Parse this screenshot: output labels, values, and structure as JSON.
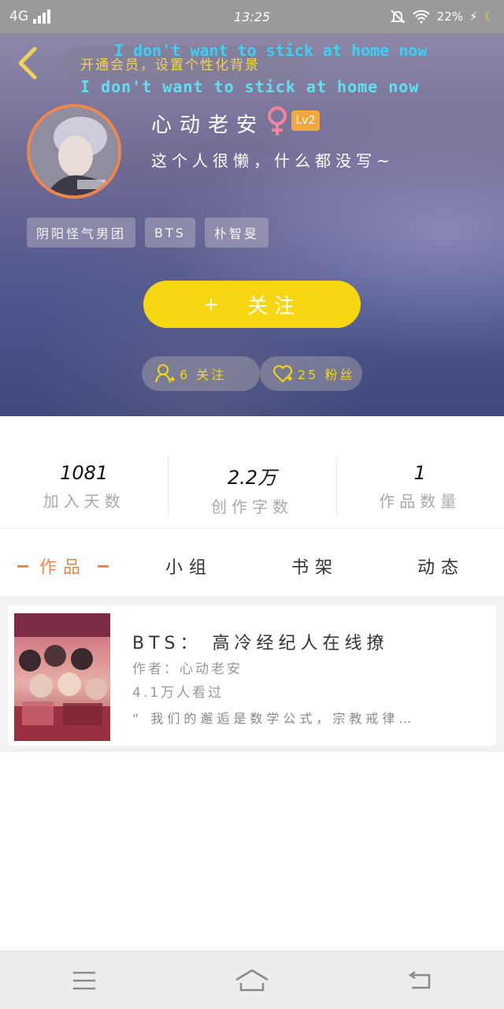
{
  "status_bar": {
    "network": "4G",
    "time": "13:25",
    "battery": "22%"
  },
  "header": {
    "vip_banner": "开通会员，设置个性化背景",
    "lyric_line_1": "I don't want to stick at home now",
    "lyric_line_2": "I don't want to stick at home now",
    "username": "心动老安",
    "gender_symbol": "♀",
    "level": "Lv2",
    "bio": "这个人很懒，什么都没写~",
    "tags": [
      "阴阳怪气男团",
      "BTS",
      "朴智旻"
    ],
    "follow_button": "关注",
    "follow_plus": "+",
    "following_count": "6 关注",
    "fans_count": "25 粉丝"
  },
  "stats": [
    {
      "value": "1081",
      "label": "加入天数"
    },
    {
      "value": "2.2万",
      "label": "创作字数"
    },
    {
      "value": "1",
      "label": "作品数量"
    }
  ],
  "tabs": [
    "作品",
    "小组",
    "书架",
    "动态"
  ],
  "works": [
    {
      "title": "BTS： 高冷经纪人在线撩",
      "author": "作者：心动老安",
      "views": "4.1万人看过",
      "excerpt": "“ 我们的邂逅是数学公式，宗教戒律…"
    }
  ],
  "colors": {
    "accent_orange": "#f0874a",
    "follow_yellow": "#f6d711",
    "vip_gold": "#f1d25a"
  }
}
